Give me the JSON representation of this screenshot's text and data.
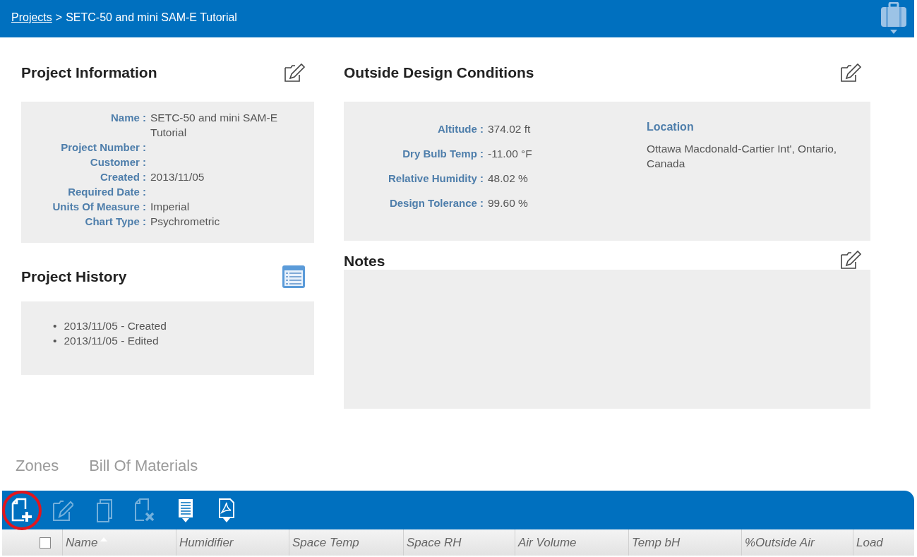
{
  "breadcrumb": {
    "link": "Projects",
    "separator": ">",
    "current": "SETC-50 and mini SAM-E Tutorial"
  },
  "project_information": {
    "title": "Project Information",
    "fields": [
      {
        "label": "Name :",
        "value": "SETC-50 and mini SAM-E Tutorial"
      },
      {
        "label": "Project Number :"
      },
      {
        "label": "Customer :"
      },
      {
        "label": "Created :",
        "value": "2013/11/05"
      },
      {
        "label": "Required Date :"
      },
      {
        "label": "Units Of Measure :",
        "value": "Imperial"
      },
      {
        "label": "Chart Type :",
        "value": "Psychrometric"
      }
    ]
  },
  "project_history": {
    "title": "Project History",
    "entries": [
      {
        "bullet": "•",
        "text": "2013/11/05 - Created"
      },
      {
        "bullet": "•",
        "text": "2013/11/05 - Edited"
      }
    ]
  },
  "outside_design_conditions": {
    "title": "Outside Design Conditions",
    "fields": [
      {
        "label": "Altitude :",
        "value": "374.02 ft"
      },
      {
        "label": "Dry Bulb Temp :",
        "value": "-11.00 °F"
      },
      {
        "label": "Relative Humidity :",
        "value": "48.02 %"
      },
      {
        "label": "Design Tolerance :",
        "value": "99.60 %"
      }
    ],
    "location_label": "Location",
    "location": "Ottawa Macdonald-Cartier Int', Ontario, Canada"
  },
  "notes": {
    "title": "Notes"
  },
  "tabs": [
    {
      "label": "Zones",
      "selected": false
    },
    {
      "label": "Bill Of Materials",
      "selected": false
    }
  ],
  "toolbar": [
    {
      "kind": "new",
      "disabled": false,
      "highlighted": true
    },
    {
      "kind": "edit",
      "disabled": true,
      "highlighted": false
    },
    {
      "kind": "copy",
      "disabled": true,
      "highlighted": false
    },
    {
      "kind": "delete",
      "disabled": true,
      "highlighted": false
    },
    {
      "kind": "csv",
      "disabled": false,
      "highlighted": false
    },
    {
      "kind": "pdf",
      "disabled": false,
      "highlighted": false
    }
  ],
  "table": {
    "select_all_checked": false,
    "columns": [
      {
        "label": "Name",
        "sorted": true
      },
      {
        "label": "Humidifier",
        "sorted": false
      },
      {
        "label": "Space Temp",
        "sorted": false
      },
      {
        "label": "Space RH",
        "sorted": false
      },
      {
        "label": "Air Volume",
        "sorted": false
      },
      {
        "label": "Temp bH",
        "sorted": false
      },
      {
        "label": "%Outside Air",
        "sorted": false
      },
      {
        "label": "Load",
        "sorted": false
      }
    ]
  }
}
